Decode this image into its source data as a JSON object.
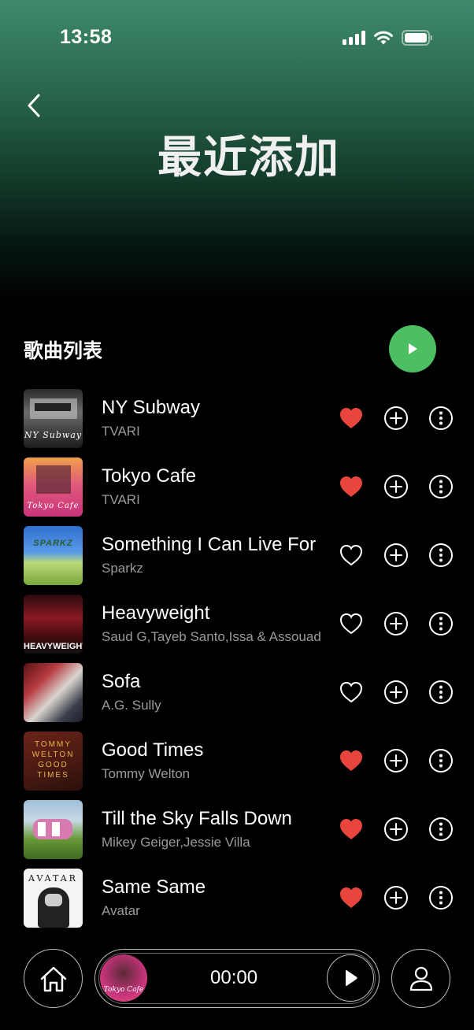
{
  "status_bar": {
    "time": "13:58",
    "icons": [
      "cellular-signal-icon",
      "wifi-icon",
      "battery-icon"
    ]
  },
  "header": {
    "back_icon": "chevron-left-icon",
    "title": "最近添加"
  },
  "section": {
    "title": "歌曲列表",
    "play_all_icon": "play-icon"
  },
  "songs": [
    {
      "title": "NY Subway",
      "artist": "TVARI",
      "liked": true,
      "cover_text": "NY Subway"
    },
    {
      "title": "Tokyo Cafe",
      "artist": "TVARI",
      "liked": true,
      "cover_text": "Tokyo Cafe"
    },
    {
      "title": "Something I Can Live For",
      "artist": "Sparkz",
      "liked": false,
      "cover_text": "SPARKZ"
    },
    {
      "title": "Heavyweight",
      "artist": "Saud G,Tayeb Santo,Issa & Assouad",
      "liked": false,
      "cover_text": "HEAVYWEIGHT"
    },
    {
      "title": "Sofa",
      "artist": "A.G. Sully",
      "liked": false,
      "cover_text": ""
    },
    {
      "title": "Good Times",
      "artist": "Tommy Welton",
      "liked": true,
      "cover_text": "TOMMY WELTON GOOD TIMES"
    },
    {
      "title": "Till the Sky Falls Down",
      "artist": "Mikey Geiger,Jessie Villa",
      "liked": true,
      "cover_text": ""
    },
    {
      "title": "Same Same",
      "artist": "Avatar",
      "liked": true,
      "cover_text": "AVATAR"
    }
  ],
  "row_actions": [
    "heart-icon",
    "add-circle-icon",
    "more-vertical-icon"
  ],
  "player": {
    "time": "00:00",
    "play_icon": "play-icon",
    "now_playing_cover_text": "Tokyo Cafe"
  },
  "nav": {
    "home_icon": "home-icon",
    "profile_icon": "user-icon"
  },
  "colors": {
    "accent_green": "#4cbf63",
    "liked_red": "#e8453c",
    "header_gradient_top": "#3f8a6a",
    "background": "#000000",
    "secondary_text": "#9a9a9a"
  }
}
